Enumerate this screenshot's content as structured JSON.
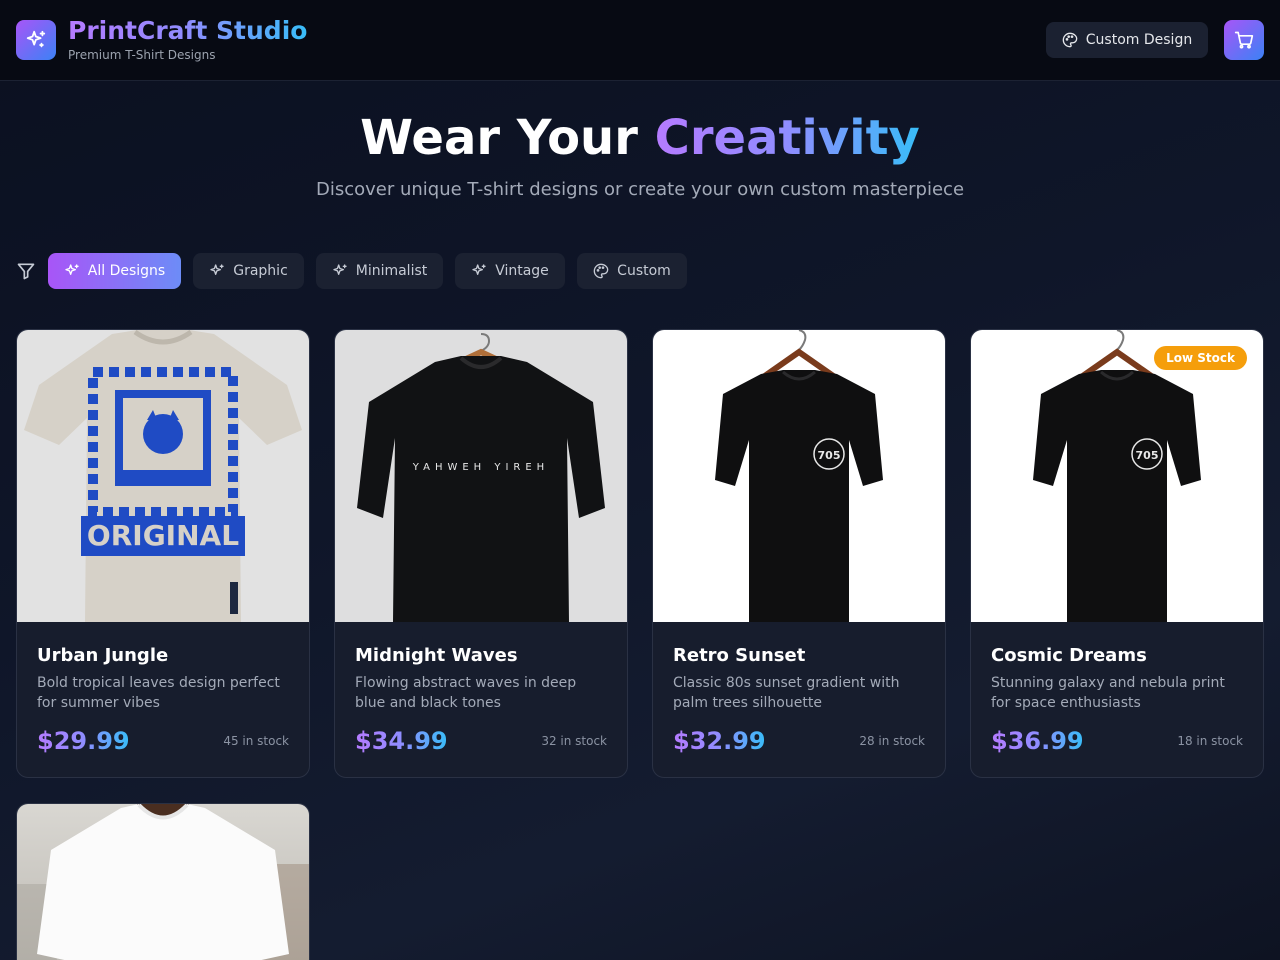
{
  "header": {
    "brand_name": "PrintCraft Studio",
    "brand_tagline": "Premium T-Shirt Designs",
    "custom_design_label": "Custom Design",
    "logo_icon": "sparkles-icon",
    "cart_icon": "shopping-cart-icon"
  },
  "hero": {
    "title_plain": "Wear Your",
    "title_accent": "Creativity",
    "subtitle": "Discover unique T-shirt designs or create your own custom masterpiece"
  },
  "filters": {
    "icon": "filter-icon",
    "items": [
      {
        "label": "All Designs",
        "icon": "sparkles-icon",
        "active": true
      },
      {
        "label": "Graphic",
        "icon": "sparkles-icon",
        "active": false
      },
      {
        "label": "Minimalist",
        "icon": "sparkles-icon",
        "active": false
      },
      {
        "label": "Vintage",
        "icon": "sparkles-icon",
        "active": false
      },
      {
        "label": "Custom",
        "icon": "palette-icon",
        "active": false
      }
    ]
  },
  "products": [
    {
      "name": "Urban Jungle",
      "description": "Bold tropical leaves design perfect for summer vibes",
      "price": "$29.99",
      "stock": "45 in stock"
    },
    {
      "name": "Midnight Waves",
      "description": "Flowing abstract waves in deep blue and black tones",
      "price": "$34.99",
      "stock": "32 in stock",
      "print_text": "YAHWEH YIREH"
    },
    {
      "name": "Retro Sunset",
      "description": "Classic 80s sunset gradient with palm trees silhouette",
      "price": "$32.99",
      "stock": "28 in stock",
      "print_text": "705"
    },
    {
      "name": "Cosmic Dreams",
      "description": "Stunning galaxy and nebula print for space enthusiasts",
      "price": "$36.99",
      "stock": "18 in stock",
      "badge": "Low Stock",
      "print_text": "705"
    },
    {
      "name": "",
      "description": "",
      "price": "",
      "stock": ""
    }
  ],
  "colors": {
    "accent_purple": "#a855f7",
    "accent_blue": "#38bdf8",
    "badge_amber": "#f59e0b"
  }
}
